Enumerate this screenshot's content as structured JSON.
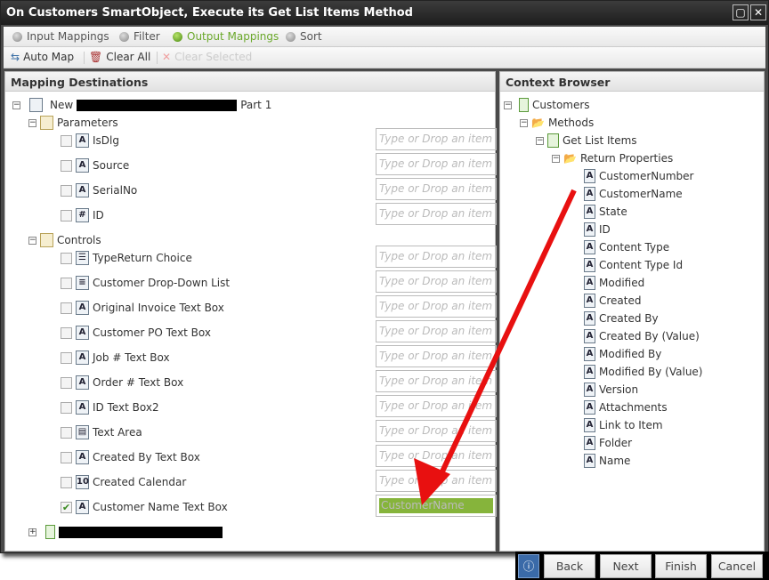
{
  "window": {
    "title": "On Customers SmartObject, Execute its Get List Items Method"
  },
  "tabs": [
    {
      "label": "Input Mappings",
      "active": false
    },
    {
      "label": "Filter",
      "active": false
    },
    {
      "label": "Output Mappings",
      "active": true
    },
    {
      "label": "Sort",
      "active": false
    }
  ],
  "toolbar": {
    "auto_map": "Auto Map",
    "clear_all": "Clear All",
    "clear_selected": "Clear Selected"
  },
  "left": {
    "header": "Mapping Destinations",
    "root_prefix": "New",
    "root_suffix": "Part 1",
    "parameters_label": "Parameters",
    "controls_label": "Controls",
    "placeholder": "Type or Drop an item",
    "parameters": [
      {
        "label": "IsDlg",
        "icon": "text-icon"
      },
      {
        "label": "Source",
        "icon": "text-icon"
      },
      {
        "label": "SerialNo",
        "icon": "text-icon"
      },
      {
        "label": "ID",
        "icon": "number-icon"
      }
    ],
    "controls": [
      {
        "label": "TypeReturn Choice",
        "icon": "choice-icon"
      },
      {
        "label": "Customer Drop-Down List",
        "icon": "dropdown-icon"
      },
      {
        "label": "Original Invoice Text Box",
        "icon": "textbox-icon"
      },
      {
        "label": "Customer PO Text Box",
        "icon": "textbox-icon"
      },
      {
        "label": "Job # Text Box",
        "icon": "textbox-icon"
      },
      {
        "label": "Order # Text Box",
        "icon": "textbox-icon"
      },
      {
        "label": "ID Text Box2",
        "icon": "textbox-icon"
      },
      {
        "label": "Text Area",
        "icon": "textarea-icon"
      },
      {
        "label": "Created By Text Box",
        "icon": "textbox-icon"
      },
      {
        "label": "Created Calendar",
        "icon": "calendar-icon"
      },
      {
        "label": "Customer Name Text Box",
        "icon": "textbox-icon",
        "checked": true,
        "value": "CustomerName"
      }
    ],
    "accent": "#86b43b"
  },
  "right": {
    "header": "Context Browser",
    "customers": "Customers",
    "methods": "Methods",
    "get_list_items": "Get List Items",
    "return_properties": "Return Properties",
    "properties": [
      "CustomerNumber",
      "CustomerName",
      "State",
      "ID",
      "Content Type",
      "Content Type Id",
      "Modified",
      "Created",
      "Created By",
      "Created By (Value)",
      "Modified By",
      "Modified By (Value)",
      "Version",
      "Attachments",
      "Link to Item",
      "Folder",
      "Name"
    ]
  },
  "footer": {
    "back": "Back",
    "next": "Next",
    "finish": "Finish",
    "cancel": "Cancel"
  },
  "annotation": {
    "arrow_color": "#e81010"
  }
}
